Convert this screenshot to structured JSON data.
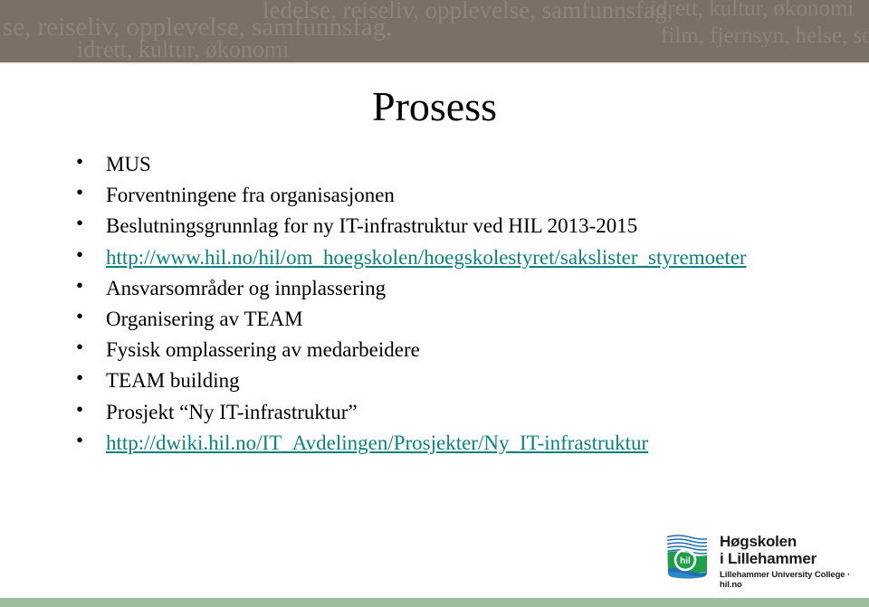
{
  "header": {
    "watermark_lines": [
      "ledelse, reiseliv, opplevelse, samfunnsfag,",
      "else, reiseliv, opplevelse, samfunnsfag,",
      "idrett, kultur, økonomi",
      "idrett, kultur, økonomi",
      "film, fjernsyn, helse, sos"
    ],
    "background_color": "#7a7068",
    "text_color": "#8e847c"
  },
  "slide": {
    "title": "Prosess",
    "title_color": "#000000",
    "link_color": "#0e8080",
    "bullet_glyph": "•",
    "bullets": [
      {
        "text": "MUS",
        "is_link": false
      },
      {
        "text": "Forventningene fra organisasjonen",
        "is_link": false
      },
      {
        "text": "Beslutningsgrunnlag for ny IT-infrastruktur ved HIL 2013-2015",
        "is_link": false
      },
      {
        "text": "http://www.hil.no/hil/om_hoegskolen/hoegskolestyret/sakslister_styremoeter",
        "is_link": true
      },
      {
        "text": "Ansvarsområder og innplassering",
        "is_link": false
      },
      {
        "text": "Organisering av TEAM",
        "is_link": false
      },
      {
        "text": "Fysisk omplassering av medarbeidere",
        "is_link": false
      },
      {
        "text": "TEAM building",
        "is_link": false
      },
      {
        "text": "Prosjekt “Ny IT-infrastruktur”",
        "is_link": false
      },
      {
        "text": "http://dwiki.hil.no/IT_Avdelingen/Prosjekter/Ny_IT-infrastruktur",
        "is_link": true
      }
    ]
  },
  "logo": {
    "line1": "Høgskolen",
    "line2": "i Lillehammer",
    "subtitle": "Lillehammer University College · hil.no",
    "emblem_mark": "hil",
    "emblem_blue": "#1f6fb5",
    "emblem_green": "#1f9e4a"
  },
  "footer": {
    "bar_color": "#9dbb9d"
  }
}
